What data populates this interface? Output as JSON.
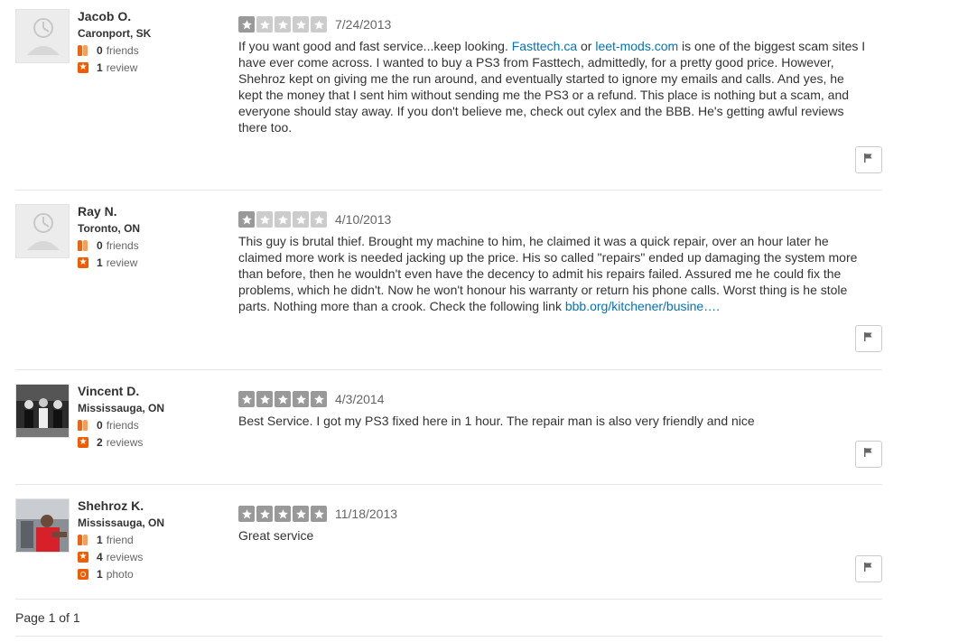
{
  "reviews": [
    {
      "user": {
        "name": "Jacob O.",
        "location": "Caronport, SK",
        "friends": "0",
        "friends_label": "friends",
        "reviews": "1",
        "reviews_label": "review",
        "avatar": "default-avatar"
      },
      "rating": 1,
      "rating_max": 5,
      "date": "7/24/2013",
      "text": [
        {
          "t": "If you want good and fast service...keep looking. "
        },
        {
          "link": "Fasttech.ca"
        },
        {
          "t": " or "
        },
        {
          "link": "leet-mods.com"
        },
        {
          "t": " is one of the biggest scam sites I have ever come across. I wanted to buy a PS3 from Fasttech, admittedly, for a pretty good price. However, Shehroz kept on giving me the run around, and eventually started to ignore my emails and calls. And yes, he kept the money that I sent him without sending me the PS3 or a refund. This place is nothing but a scam, and everyone should stay away. If you don't believe me, check out cylex and the BBB. He's getting awful reviews there too."
        }
      ]
    },
    {
      "user": {
        "name": "Ray N.",
        "location": "Toronto, ON",
        "friends": "0",
        "friends_label": "friends",
        "reviews": "1",
        "reviews_label": "review",
        "avatar": "default-avatar"
      },
      "rating": 1,
      "rating_max": 5,
      "date": "4/10/2013",
      "text": [
        {
          "t": "This guy is brutal thief. Brought my machine to him, he claimed it was a quick repair, over an hour later he claimed more work is needed jacking up the price. His so called \"repairs\" ended up damaging the system more than before, then he wouldn't even have the decency to admit his repairs failed. Assured me he could fix the problems, which he didn't. Now he won't honour his warranty or return his phone calls. Worst thing is he stole parts. Nothing more than a crook. Check the following link "
        },
        {
          "link": "bbb.org/kitchener/busine…."
        }
      ]
    },
    {
      "user": {
        "name": "Vincent D.",
        "location": "Mississauga, ON",
        "friends": "0",
        "friends_label": "friends",
        "reviews": "2",
        "reviews_label": "reviews",
        "avatar": "photo-group"
      },
      "rating": 5,
      "rating_max": 5,
      "date": "4/3/2014",
      "text": [
        {
          "t": "Best Service. I got my PS3 fixed here in 1 hour. The repair man is also very friendly and nice"
        }
      ]
    },
    {
      "user": {
        "name": "Shehroz K.",
        "location": "Mississauga, ON",
        "friends": "1",
        "friends_label": "friend",
        "reviews": "4",
        "reviews_label": "reviews",
        "photos": "1",
        "photos_label": "photo",
        "avatar": "photo-person-red"
      },
      "rating": 5,
      "rating_max": 5,
      "date": "11/18/2013",
      "text": [
        {
          "t": "Great service"
        }
      ]
    }
  ],
  "pager": {
    "label": "Page 1 of 1"
  },
  "colors": {
    "star_on": "#999999",
    "star_off": "#cccccc",
    "link": "#0073bb",
    "icon_accent": "#f15c00"
  }
}
